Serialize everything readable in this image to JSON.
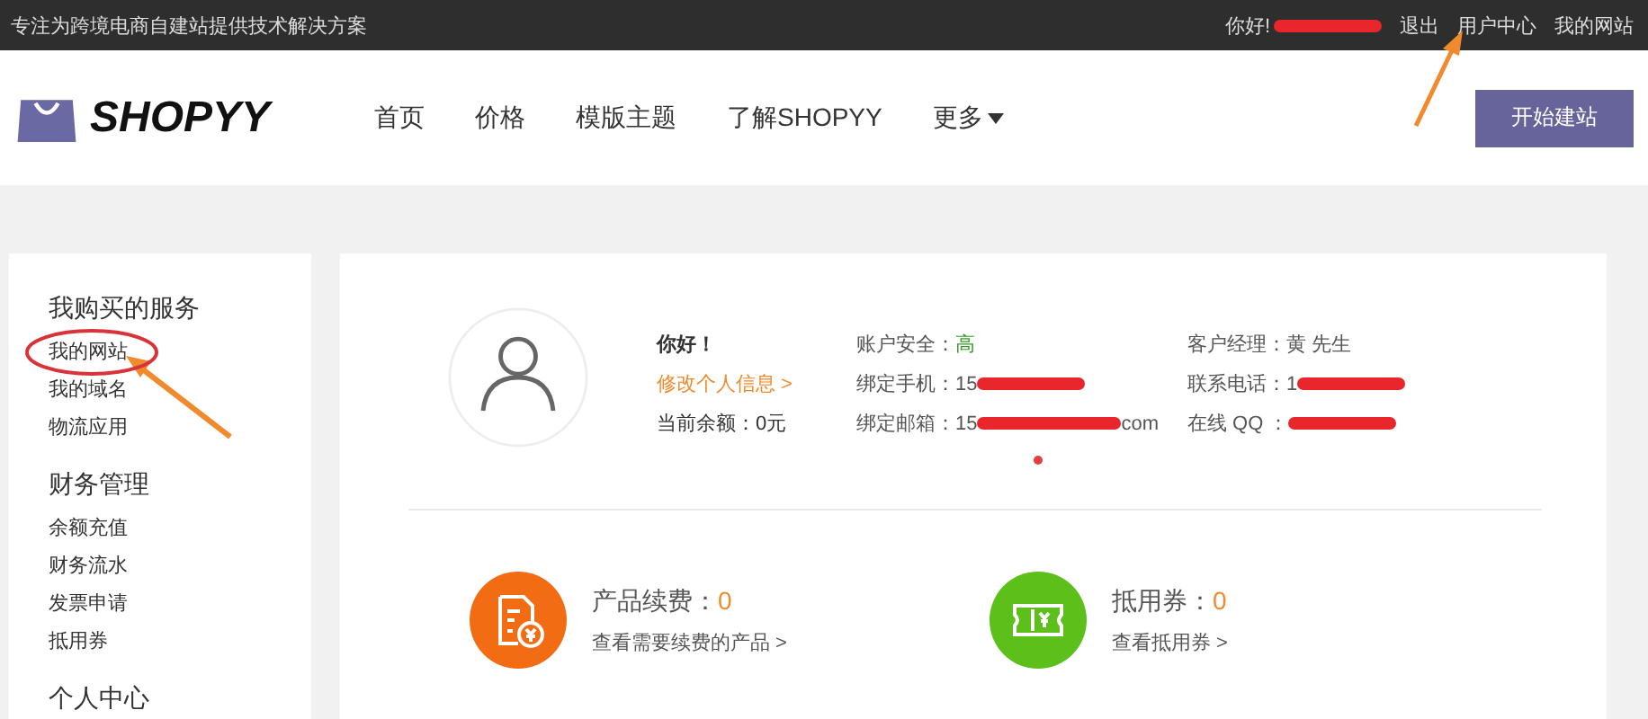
{
  "top_bar": {
    "slogan": "专注为跨境电商自建站提供技术解决方案",
    "greeting": "你好!",
    "links": [
      "退出",
      "用户中心",
      "我的网站"
    ]
  },
  "header": {
    "logo": "SHOPYY",
    "nav": [
      {
        "label": "首页",
        "dropdown": false
      },
      {
        "label": "价格",
        "dropdown": false
      },
      {
        "label": "模版主题",
        "dropdown": false
      },
      {
        "label": "了解SHOPYY",
        "dropdown": false
      },
      {
        "label": "更多",
        "dropdown": true
      }
    ],
    "cta": "开始建站"
  },
  "sidebar": [
    {
      "title": "我购买的服务",
      "items": [
        "我的网站",
        "我的域名",
        "物流应用"
      ]
    },
    {
      "title": "财务管理",
      "items": [
        "余额充值",
        "财务流水",
        "发票申请",
        "抵用券"
      ]
    },
    {
      "title": "个人中心"
    }
  ],
  "profile": {
    "hello": "你好！",
    "edit_link": "修改个人信息 >",
    "balance": "当前余额：0元",
    "security_label": "账户安全：",
    "security_value": "高",
    "phone_label": "绑定手机：",
    "phone_value": "15",
    "email_label": "绑定邮箱：",
    "email_value": "15",
    "email_tail": "com",
    "manager": "客户经理：黄 先生",
    "contact_label": "联系电话：",
    "contact_value": "1",
    "qq_label": "在线 QQ ："
  },
  "cards": [
    {
      "kind": "renewal",
      "label": "产品续费：",
      "count": "0",
      "link": "查看需要续费的产品 >",
      "color": "#f26c14"
    },
    {
      "kind": "coupon",
      "label": "抵用券：",
      "count": "0",
      "link": "查看抵用券 >",
      "color": "#5cbf1a"
    }
  ]
}
